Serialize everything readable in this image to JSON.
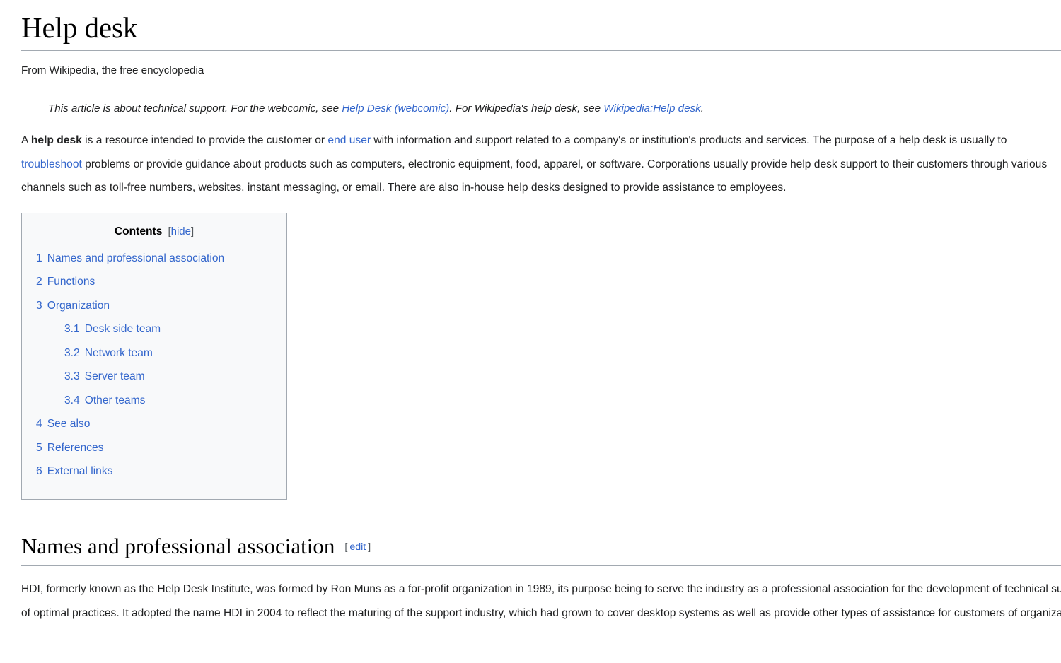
{
  "article": {
    "title": "Help desk",
    "tagline": "From Wikipedia, the free encyclopedia"
  },
  "hatnote": {
    "part1": "This article is about technical support. For the webcomic, see ",
    "link1": "Help Desk (webcomic)",
    "part2": ". For Wikipedia's help desk, see ",
    "link2": "Wikipedia:Help desk",
    "part3": "."
  },
  "lead": {
    "seg1": "A ",
    "bold1": "help desk",
    "seg2": " is a resource intended to provide the customer or ",
    "link1": "end user",
    "seg3": " with information and support related to a company's or institution's products and services. The purpose of a help desk is usually to ",
    "link2": "troubleshoot",
    "seg4": " problems or provide guidance about products such as computers, electronic equipment, food, apparel, or software. Corporations usually provide help desk support to their customers through various channels such as toll-free numbers, websites, instant messaging, or email. There are also in-house help desks designed to provide assistance to employees."
  },
  "toc": {
    "heading": "Contents",
    "bracket_open": "[",
    "toggle_label": "hide",
    "bracket_close": "]",
    "items": [
      {
        "num": "1",
        "label": "Names and professional association",
        "level": 1
      },
      {
        "num": "2",
        "label": "Functions",
        "level": 1
      },
      {
        "num": "3",
        "label": "Organization",
        "level": 1
      },
      {
        "num": "3.1",
        "label": "Desk side team",
        "level": 2
      },
      {
        "num": "3.2",
        "label": "Network team",
        "level": 2
      },
      {
        "num": "3.3",
        "label": "Server team",
        "level": 2
      },
      {
        "num": "3.4",
        "label": "Other teams",
        "level": 2
      },
      {
        "num": "4",
        "label": "See also",
        "level": 1
      },
      {
        "num": "5",
        "label": "References",
        "level": 1
      },
      {
        "num": "6",
        "label": "External links",
        "level": 1
      }
    ]
  },
  "section1": {
    "title": "Names and professional association",
    "edit_bracket_open": "[",
    "edit_label": "edit",
    "edit_bracket_close": "]",
    "paragraph": "HDI, formerly known as the Help Desk Institute, was formed by Ron Muns as a for-profit organization in 1989, its purpose being to serve the industry as a professional association for the development of technical support personnel and the sharing of optimal practices. It adopted the name HDI in 2004 to reflect the maturing of the support industry, which had grown to cover desktop systems as well as provide other types of assistance for customers of organizations."
  },
  "colors": {
    "link": "#3366cc",
    "rule": "#a2a9b1",
    "toc_background": "#f8f9fa",
    "text": "#202122"
  }
}
